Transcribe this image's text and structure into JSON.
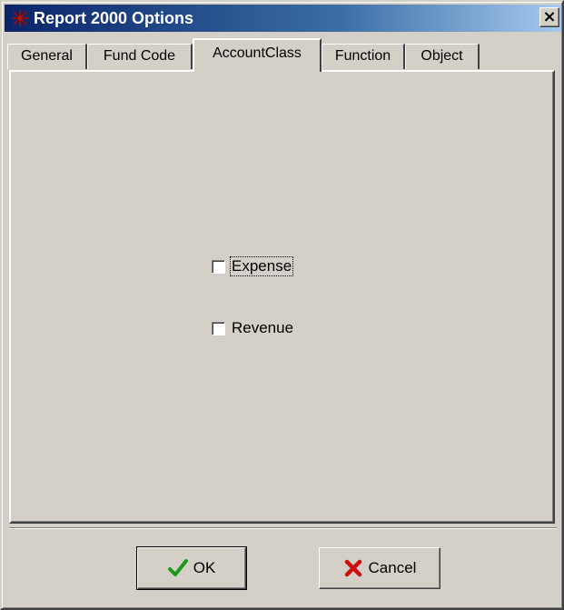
{
  "window": {
    "title": "Report 2000 Options",
    "close_glyph": "×",
    "title_icon": "app-icon"
  },
  "tabs": [
    {
      "label": "General",
      "active": false
    },
    {
      "label": "Fund Code",
      "active": false
    },
    {
      "label": "AccountClass",
      "active": true
    },
    {
      "label": "Function",
      "active": false
    },
    {
      "label": "Object",
      "active": false
    }
  ],
  "panel": {
    "checkboxes": [
      {
        "label": "Expense",
        "checked": false,
        "focused": true
      },
      {
        "label": "Revenue",
        "checked": false,
        "focused": false
      }
    ]
  },
  "buttons": {
    "ok": {
      "label": "OK",
      "icon": "checkmark-icon",
      "color": "#1a9a1a"
    },
    "cancel": {
      "label": "Cancel",
      "icon": "x-icon",
      "color": "#cc1010"
    }
  },
  "colors": {
    "dialog_face": "#d4d0c8",
    "titlebar_start": "#0a246a",
    "titlebar_end": "#a6caf0"
  }
}
